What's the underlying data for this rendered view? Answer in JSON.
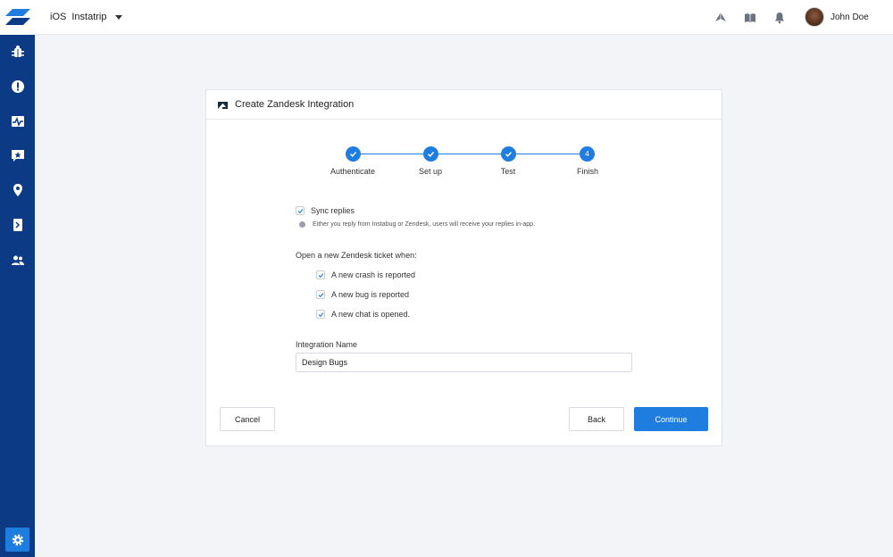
{
  "colors": {
    "sidebar": "#0d3a85",
    "accent": "#1f7de0",
    "background": "#f3f4f7"
  },
  "sidebar": {
    "items": [
      {
        "name": "bug-icon"
      },
      {
        "name": "crash-icon"
      },
      {
        "name": "apm-icon"
      },
      {
        "name": "feature-requests-icon"
      },
      {
        "name": "location-icon"
      },
      {
        "name": "app-review-icon"
      },
      {
        "name": "users-icon"
      }
    ],
    "settings_icon": "gear-icon"
  },
  "topbar": {
    "platform": "iOS",
    "app_name": "Instatrip",
    "icons": [
      "announcement-icon",
      "book-icon",
      "bell-icon"
    ],
    "user_name": "John Doe"
  },
  "card": {
    "title": "Create Zandesk Integration",
    "steps": [
      {
        "label": "Authenticate",
        "state": "done",
        "marker": ""
      },
      {
        "label": "Set up",
        "state": "done",
        "marker": ""
      },
      {
        "label": "Test",
        "state": "done",
        "marker": ""
      },
      {
        "label": "Finish",
        "state": "current",
        "marker": "4"
      }
    ],
    "sync": {
      "label": "Sync replies",
      "checked": true,
      "hint": "Either you reply from Instabug or Zendesk, users will receive your replies in-app."
    },
    "open_ticket_label": "Open a new Zendesk ticket when:",
    "ticket_options": [
      {
        "label": "A new crash is reported",
        "checked": true
      },
      {
        "label": "A new bug is reported",
        "checked": true
      },
      {
        "label": "A new chat is opened.",
        "checked": true
      }
    ],
    "integration_name": {
      "label": "Integration Name",
      "value": "Design Bugs"
    },
    "buttons": {
      "cancel": "Cancel",
      "back": "Back",
      "continue": "Continue"
    }
  }
}
